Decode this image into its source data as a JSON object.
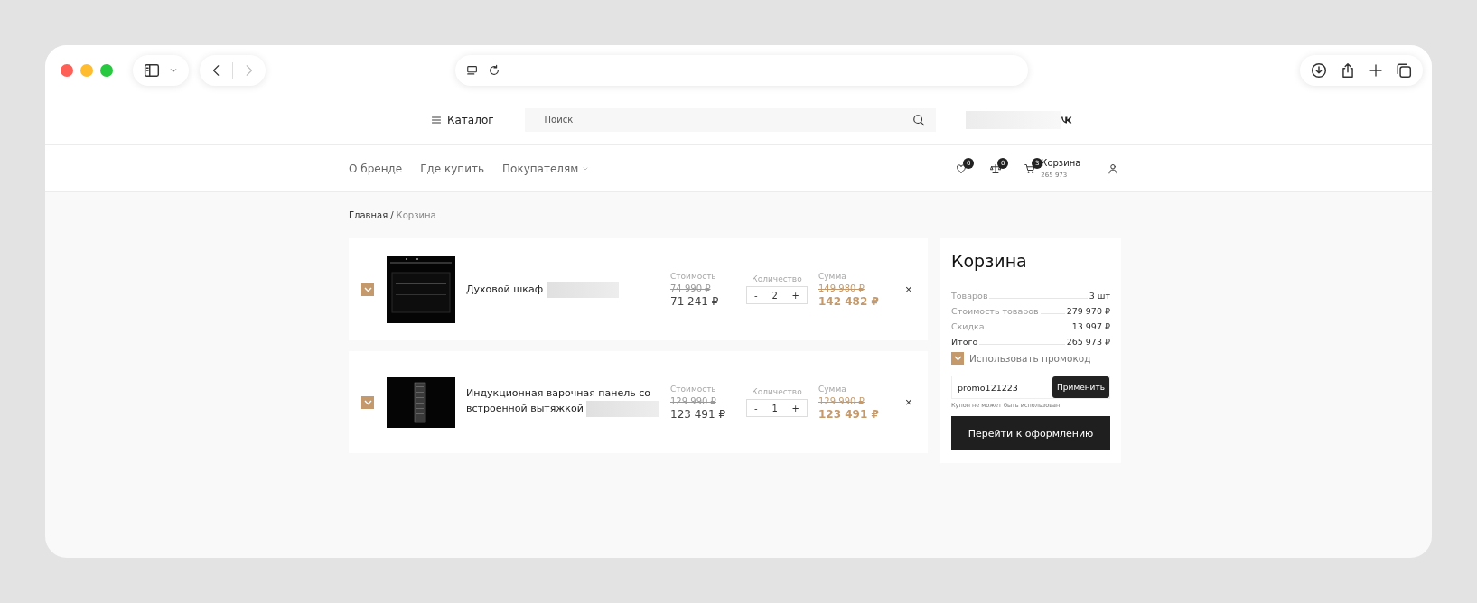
{
  "header": {
    "catalog": "Каталог",
    "search": {
      "placeholder": "Поиск"
    }
  },
  "nav": {
    "links": [
      "О бренде",
      "Где купить",
      "Покупателям"
    ],
    "favorites_count": "0",
    "compare_count": "0",
    "cart_count": "3",
    "cart_label": "Корзина",
    "cart_total": "265 973"
  },
  "breadcrumb_separator": "/",
  "breadcrumbs": [
    {
      "label": "Главная",
      "selected": false
    },
    {
      "label": "Корзина",
      "selected": true
    }
  ],
  "cart_items": [
    {
      "kind": "oven",
      "checked": true,
      "name": "Духовой шкаф",
      "price_label": "Стоимость",
      "old_price": "74 990 ₽",
      "price": "71 241 ₽",
      "qty_label": "Количество",
      "minus": "-",
      "quantity": "2",
      "plus": "+",
      "sum_label": "Сумма",
      "old_sum": "149 980 ₽",
      "sum": "142 482 ₽",
      "remove": "×"
    },
    {
      "kind": "hob",
      "checked": true,
      "name": "Индукционная варочная панель со встроенной вытяжкой",
      "price_label": "Стоимость",
      "old_price": "129 990 ₽",
      "price": "123 491 ₽",
      "qty_label": "Количество",
      "minus": "-",
      "quantity": "1",
      "plus": "+",
      "sum_label": "Сумма",
      "old_sum": "129 990 ₽",
      "sum": "123 491 ₽",
      "remove": "×"
    }
  ],
  "summary": {
    "title": "Корзина",
    "rows": [
      {
        "label": "Товаров",
        "value": "3 шт",
        "kind": "muted"
      },
      {
        "label": "Стоимость товаров",
        "value": "279 970 ₽",
        "kind": "muted"
      },
      {
        "label": "Скидка",
        "value": "13 997 ₽",
        "kind": "muted"
      },
      {
        "label": "Итого",
        "value": "265 973 ₽",
        "kind": "total"
      }
    ],
    "promo": {
      "label": "Использовать промокод",
      "checked": true,
      "value": "promo121223",
      "apply": "Применить",
      "error": "Купон не может быть использован"
    },
    "checkout": "Перейти к оформлению"
  }
}
